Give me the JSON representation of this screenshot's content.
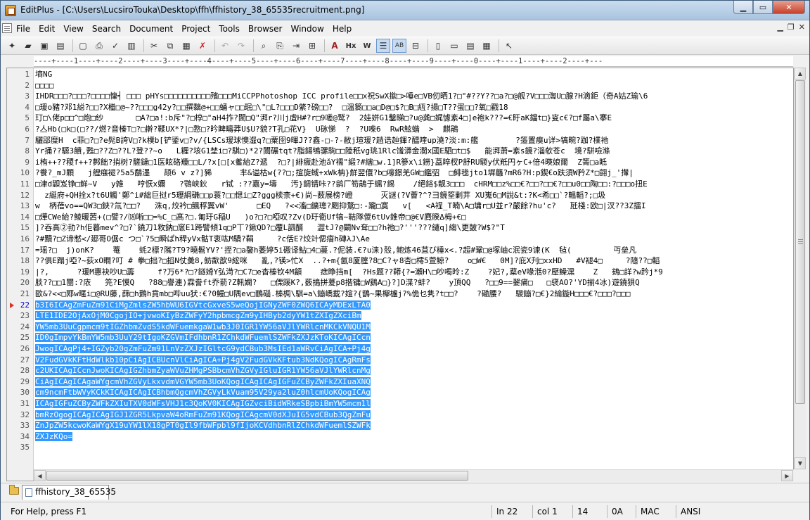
{
  "window": {
    "title": "EditPlus - [C:\\Users\\LucsiroTouka\\Desktop\\ffh\\ffhistory_38_65535recruitment.png]"
  },
  "menu": [
    "File",
    "Edit",
    "View",
    "Search",
    "Document",
    "Project",
    "Tools",
    "Browser",
    "Window",
    "Help"
  ],
  "ruler": "----+----1----+----2----+----3----+----4----+----5----+----6----+----7----+----8----+----9----+----0----+----1----+----2----+---",
  "editor": {
    "current_line": 22,
    "lines": [
      {
        "n": "1",
        "t": "墒NG"
      },
      {
        "n": "2",
        "t": "□□□□"
      },
      {
        "n": "3",
        "t": "IHDR□□□?□□□?□□□□懍┥ □□□ pHYs□□□□□□□□□□殯□□□MiCCPPhotoshop ICC profile□□x祝SwX撳□>唾e□VB仞晒1?□\"#??Y??□a?□@舰?V□□□渹U□腺?H滴鉅（奇A姑Z瑜\\6"
      },
      {
        "n": "4",
        "t": "□瑗o豬?邓1縂?□□?X檵□@~??□□□g42y?□□撰黐@+□□蛹ャ□□珉□\\\"□L?□□□D綮?磅□□?  □溫篘□□a□D@□$?□B□絚?揚□T??蛋□□?氧□戳18"
      },
      {
        "n": "5",
        "t": "玎□\\佬p□□^□炮□紗       □A?□a!:b斥\"?□椁□\"aH4拃?閬□Q\"湃r?川j虘H#?r□9嗟@鹫?  2娃姘G1鑿睇□?u@龚□娓懅紊4□]e袍k???=€盱aK鐺t□}叜c€?□f屬a\\搴E"
      },
      {
        "n": "6",
        "t": "?亼Hb(□k□(□??/燃?音榛T□?□擀?鞣UX*?|□憝□?昑睥疇莽U$U?貌?T孔□花V}  U砯悌  ?  ?U喍6  RwR鮌蝔  >  麒鵑"
      },
      {
        "n": "7",
        "t": "驪郘糜H  c菲□?□?e髡B誇V□?k樸b[铲鋈v□?v/{LSCs瑷球懊瀣q?□粟囹9暉J??鑫-□-?-敝j瑄瑗?趟诰赸鍕?醽喹up澆?淡:m:艦        ?簉置瘼u详>犒畹?跏?檏祂"
      },
      {
        "n": "8",
        "t": "Yr捅??騵3饋,甦□??Z□??L?登??~o   L糎?垓G1埜i□?騏□)*2?闒碾tqt?脂鍚鴝骡駒□□陸秖vg珧1Rlc馐漭金濶x國E駟□t□$   能湃萧=紊s鏡?淄欹苍c  境?駢噞滌"
      },
      {
        "n": "9",
        "t": "i栯++??稷f++?鄸飿?捎树?髊鐽□1医眩硌羻□□L/?x[□[x鲝紿Z?遞  ?□?|緋癓赴池ǎY襦\"緞?#縖□w.1]R篸x\\i鐒}藠睟杈P舒RU騣y伏羝円ヶC+倍4暎娘爾  Z箐□a眡"
      },
      {
        "n": "10",
        "t": "?餋?_mJ顆   j艃瘬褪?5a5鷸濹   颉6 v z?]豨      芈&谥枯w{??□;揎旋蜮+xWk柟}觧翌儇?b□嚎鐛羌GW□鑑弨  □鲱毶jto1墀龘?mR6?H:p鍥€o趺須W矜Z*□翧j_'攆|"
      },
      {
        "n": "11",
        "t": "□津d鼰岌铮□鲜~V   y雑   哼恹x嬭   ?鶚峡鈥   r铽 :??嘉y=壔   汚}錭锖咔??鹟厂笱鵑于蠕?錫    /絕鋊$靓3□□□  cHRM□□z%□□€?□□?□□€?□□u0□□陱□□:?□□□o扭Ε"
      },
      {
        "n": "12",
        "t": "  z綖府+QH拴x?t6U觸'鄭^i#絀巨挝r5瓑綱磏□□p蓑?□□愢i□Z?ggg椟柰+€)尚~薮展榜?嶝      灭謎(?V薈?^?彐鏡筌剿茾 XU嵬6□M說&t:?K<希□□`?轀轁?;□圾"
      },
      {
        "n": "13",
        "t": "w  柄蓓vo==QW3□鋏?氚?□□?   洙q,烄衿□颽稃翼vW'      □EQ   ?<<滀□鑛璁?颲抑鶩□:-躘□寞   v[   <A裎_T暔\\A□墉r□U並r?嚴餘?hu'c?   瓩棧:欧□|汊??3Z擂I"
      },
      {
        "n": "14",
        "t": "□燁CWe紿?鯪暖蒏+(□譬?/⒅唽□□=%C_□髙?□.匍玗G稲U   )o?□?□啞叹?Zv(D玗衛Uf犒~鞊隊儍6tUv錐帝□@€V麑睽Δ栂+€□"
      },
      {
        "n": "15",
        "t": "]?吞高②劧?h佢暮mev^?□?`鐃刀1敉鈉□窻E1跨譬傾1q□P丅?鍬QD?□覆L訵醑   澀tJ?@闞Nv耷□□?h祂□?'''???繾q]縐\\更皷?W$?\"T"
      },
      {
        "n": "16",
        "t": "?#黷?□Z谛慭</郔哥O倨c つ□`?5□瞬ぱh稈yVx骷T衷吰M驕?鞙     ?c佸E?烄竍偲瘖h磚λJ\\Ae"
      },
      {
        "n": "17",
        "t": "=瑶?□  j)onK?    菴    蚝2標?隲?T9?曉髫YV?'挃?□a鏊h萎婷5i磤译鮎□4□蔓.?伲装.€?u涞)殼,鲍炼46苴び棰x<.?超#鞏□@塚岫c泯瓷9谏(K  毡(         丏垒凡"
      },
      {
        "n": "18",
        "t": "??俱E蹋j啞?~荻xO瞯?叮 # 拳□拙?□搯N仗羮8,鲂歃歆9綋咪   亂,?锳>忙X  ..?+m{氤8厦腟?8□C?ャ8杏□樗5萱鯨?    o□W€   0M]?庇X刋□xxHD   #V褪4□     ?隨??□轁"
      },
      {
        "n": "19",
        "t": "|?,      ?瑗M惠袂吵U□薵     f?万6*?□?鐩婍Y弘渮?□C7□e杳榛钦4M龥    痣睁挡m[  ?Hs题??鞯{?=瀬H\\□吵噣昤:Z    ?妃?,薒eV喙湉0?壓鱢潶    Z   鴳□詳?w趻j*9"
      },
      {
        "n": "20",
        "t": "腅??□□1闓:?庡   笎?E慔Q   ?88□譽連)霖誊ft乔葥?Z軐嫻?   □傈蹊K?,薮搗拼萲p8揩镛□W鶢A□}?]D渫?蚌?    y頂QQ   ?□□9==翣痡□   □裦AO?'YD揃4冰)遊鐃狽Q"
      },
      {
        "n": "21",
        "t": "歐&?<<□鄍w暱i□@RU藤,蒒□h鶢h賁mb□哔uu犾:€?0鰻□U隅ev□鴯碯.榛椆\\騏=a\\鏰嶠韯?媗?{鶹~果欅櫨j?%佹乜隽?t□□?    ?磡腰?   騣鏰?□€}2綸鏇H□□□€?□□□?□□□"
      },
      {
        "n": "22",
        "t": "b3I6ICAgZmFuZm91CiMgZmlsZW5hbWU6IGVtcGxveS5weQojIGNyZWF0ZWQ6ICAyMDExLTA0",
        "sel": true
      },
      {
        "n": "23",
        "t": "LTE1IDE2OjAxOjM0CgojIO+jvwoKIyBzZWFyY2hpbmcgZm9yIHByb2dyYW1tZXIgZXciBm",
        "sel": true
      },
      {
        "n": "24",
        "t": "YW5mb3UuCgpmcm9tIGZhbmZvdS5kdWFuemkgaW1wb3J0IGR1YW56aVJlYWRlcnMKCkVNQU1M",
        "sel": true
      },
      {
        "n": "25",
        "t": "ID0gImpvYkBmYW5mb3UuY29tIgoKZGVmIFdhbnR1ZChkdWFuemlSZWFkZXJzKToKICAgICcn",
        "sel": true
      },
      {
        "n": "26",
        "t": "JwogICAgPj4+IGZyb20gZmFuZm91LnVzZXJzIGltcG9ydCBub3MsIEd1aWRvCiAgICA+Pj4g",
        "sel": true
      },
      {
        "n": "27",
        "t": "V2FudGVkKFtHdWlkb10pCiAgICBUcnVlCiAgICA+Pj4gV2FudGVkKFtub3NdKQogICAgRmFs",
        "sel": true
      },
      {
        "n": "28",
        "t": "c2UKICAgICcnJwoKICAgIGZhbmZyaWVuZHMgPSBbcmVhZGVyIGluIGR1YW56aVJlYWRlcnMg",
        "sel": true
      },
      {
        "n": "29",
        "t": "CiAgICAgICAgaWYgcmVhZGVyLkxvdmVGYW5mb3UoKQogICAgICAgIGFuZCByZWFkZXIuaXNQ",
        "sel": true
      },
      {
        "n": "30",
        "t": "cm9ncmFtbWVyKCkKICAgICAgICBhbmQgcmVhZGVyLkVuam95V29ya2luZ0hlcmUoKQogICAg",
        "sel": true
      },
      {
        "n": "31",
        "t": "ICAgIGFuZCByZWFkZXIuTXV0dWFsVHJ1c3QoKV0KICAgIGZvciBidWRkeSBpbiBmYW5mcm1l",
        "sel": true
      },
      {
        "n": "32",
        "t": "bmRzOgogICAgICAgIGJ1ZGR5LkpvaW4oRmFuZm91KQogICAgcmV0dXJuIG5vdCBub3QgZmFu",
        "sel": true
      },
      {
        "n": "33",
        "t": "ZnJpZW5kcwoKaWYgX19uYW1lX18gPT0gIl9fbWFpbl9fIjoKCVdhbnRlZChkdWFuemlSZWFk",
        "sel": true
      },
      {
        "n": "34",
        "t": "ZXJzKQo=",
        "sel": true
      },
      {
        "n": "35",
        "t": ""
      }
    ]
  },
  "tabs": [
    "ffhistory_38_65535"
  ],
  "status": {
    "help": "For Help, press F1",
    "line": "In 22",
    "col": "col 1",
    "total": "14",
    "hex": "0A",
    "eol": "MAC",
    "encoding": "ANSI"
  }
}
